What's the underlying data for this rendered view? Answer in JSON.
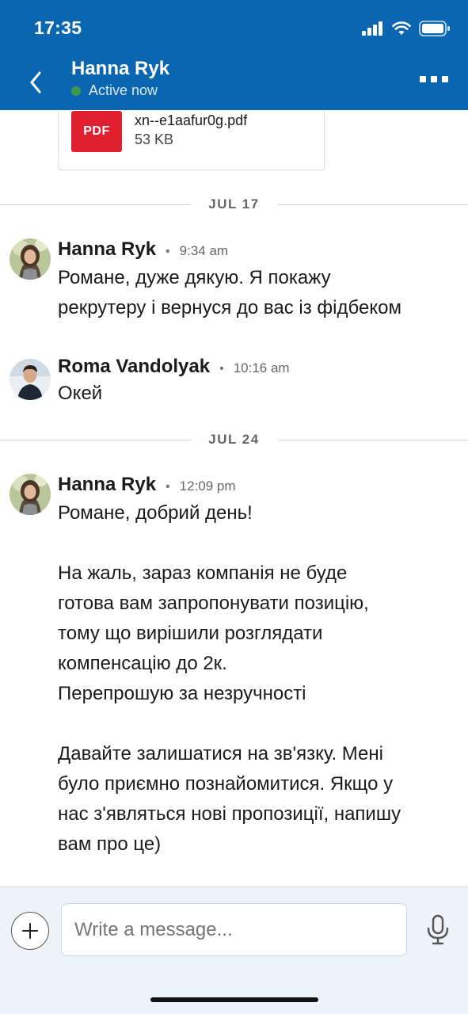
{
  "status_bar": {
    "time": "17:35",
    "signal_icon": "signal-bars-icon",
    "wifi_icon": "wifi-icon",
    "battery_icon": "battery-icon"
  },
  "header": {
    "back_icon": "chevron-left-icon",
    "contact_name": "Hanna Ryk",
    "presence": "Active now",
    "presence_color": "#3d9a4c",
    "more_icon": "more-dots-icon",
    "bar_color": "#0a66b0"
  },
  "attachment": {
    "badge": "PDF",
    "file_name": "xn--e1aafur0g.pdf",
    "file_size": "53 KB",
    "badge_color": "#e0202f"
  },
  "date_separators": [
    "JUL 17",
    "JUL 24"
  ],
  "messages": [
    {
      "sender": "Hanna Ryk",
      "time": "9:34 am",
      "lines": [
        "Романе, дуже дякую. Я покажу",
        "рекрутеру і вернуся до вас із фідбеком"
      ]
    },
    {
      "sender": "Roma Vandolyak",
      "time": "10:16 am",
      "lines": [
        "Окей"
      ]
    },
    {
      "sender": "Hanna Ryk",
      "time": "12:09 pm",
      "lines": [
        "Романе, добрий день!",
        "",
        "На жаль, зараз компанія не буде",
        "готова вам запропонувати позицію,",
        "тому що вирішили розглядати",
        "компенсацію до 2к.",
        "Перепрошую за незручності",
        "",
        "Давайте залишатися на зв'язку. Мені",
        "було приємно познайомитися. Якщо у",
        "нас з'являться нові пропозиції, напишу",
        "вам про це)"
      ]
    }
  ],
  "separator": "•",
  "composer": {
    "placeholder": "Write a message...",
    "add_icon": "plus-icon",
    "mic_icon": "microphone-icon"
  }
}
